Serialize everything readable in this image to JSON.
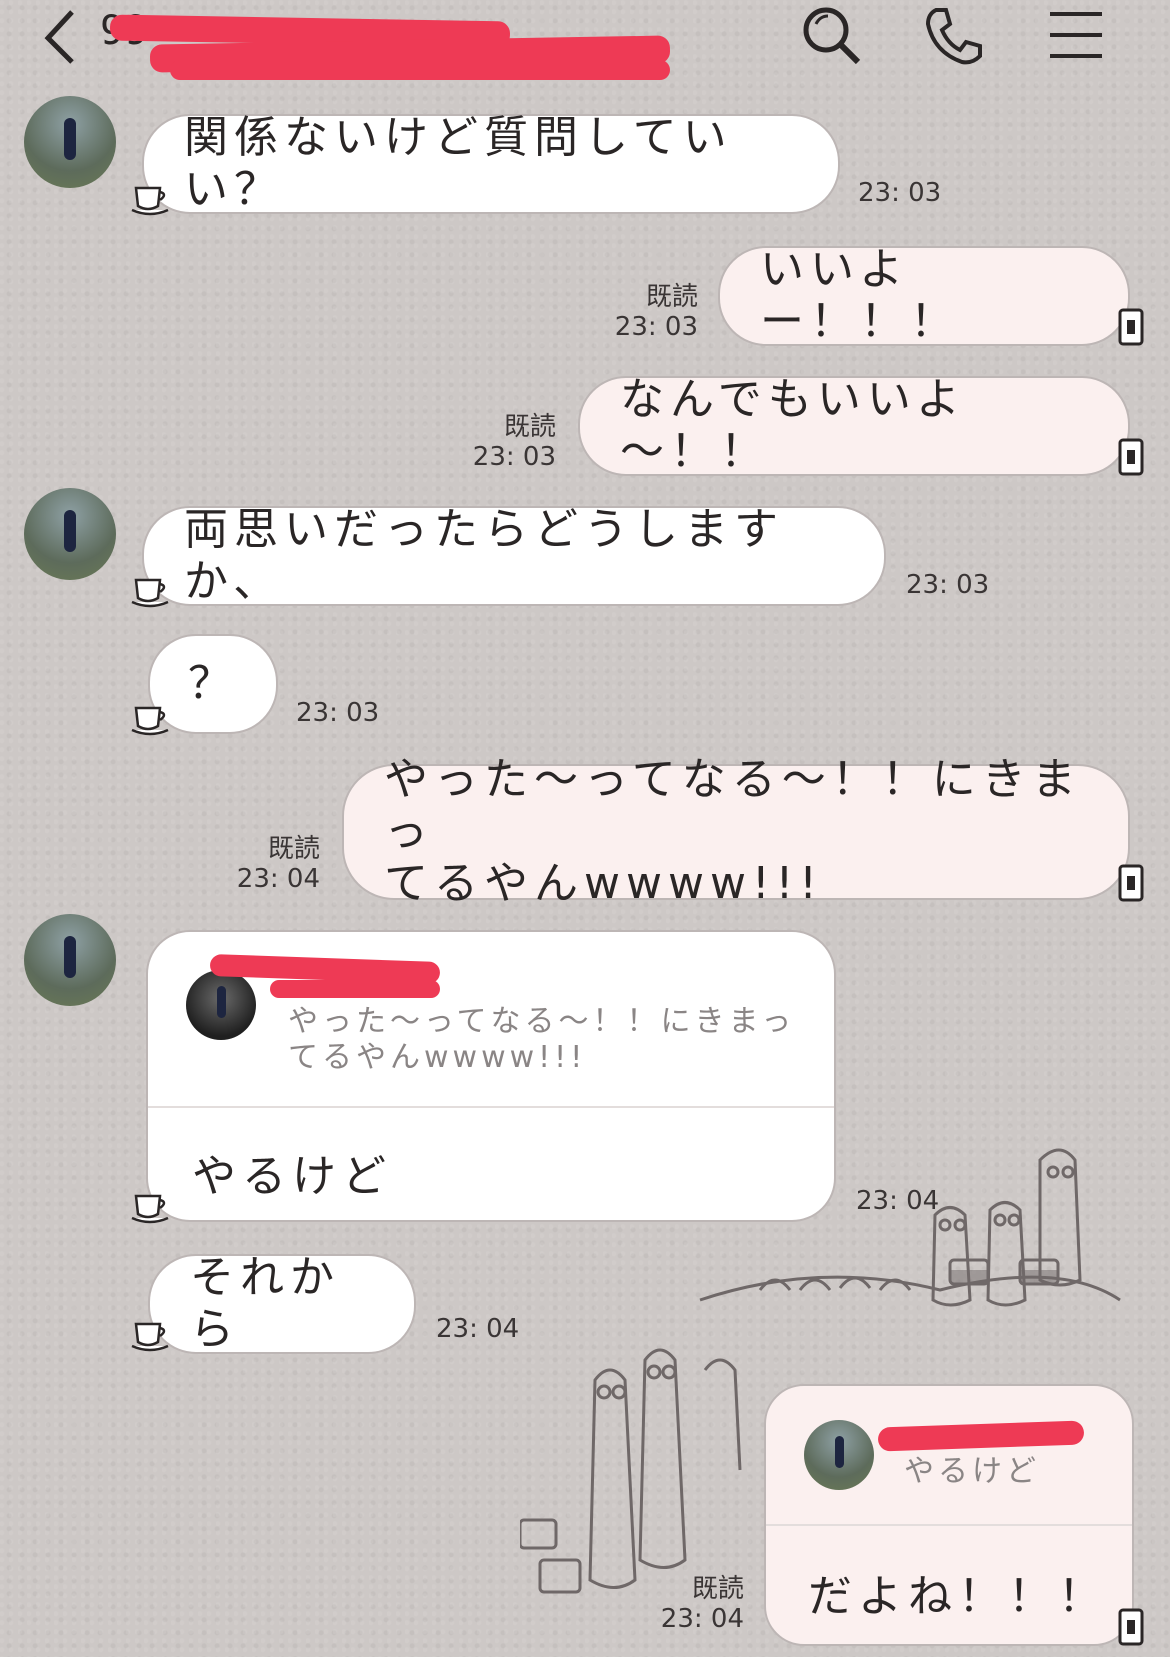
{
  "header": {
    "back_icon": "chevron-left-icon",
    "title_prefix": "99",
    "search_icon": "search-icon",
    "call_icon": "phone-icon",
    "menu_icon": "menu-icon"
  },
  "messages": [
    {
      "side": "left",
      "text": "関係ないけど質問していい？",
      "time": "23: 03"
    },
    {
      "side": "right",
      "text": "いいよー！！！",
      "read": "既読",
      "time": "23: 03"
    },
    {
      "side": "right",
      "text": "なんでもいいよ～！！",
      "read": "既読",
      "time": "23: 03"
    },
    {
      "side": "left",
      "text": "両思いだったらどうしますか、",
      "time": "23: 03"
    },
    {
      "side": "left",
      "text": "？",
      "time": "23: 03"
    },
    {
      "side": "right",
      "text": "やった～ってなる～！！にきまっ\nてるやんwwww!!!",
      "read": "既読",
      "time": "23: 04"
    },
    {
      "side": "left",
      "quote": "やった～ってなる～！！にきまっ\nてるやんwwww!!!",
      "text": "やるけど",
      "time": "23: 04"
    },
    {
      "side": "left",
      "text": "それから",
      "time": "23: 04"
    },
    {
      "side": "right",
      "quote": "やるけど",
      "text": "だよね！！！",
      "read": "既読",
      "time": "23: 04"
    }
  ],
  "colors": {
    "background": "#cdc8c6",
    "bubble_left": "#ffffff",
    "bubble_right": "#fbf0ef",
    "redaction": "#ee3a55"
  }
}
